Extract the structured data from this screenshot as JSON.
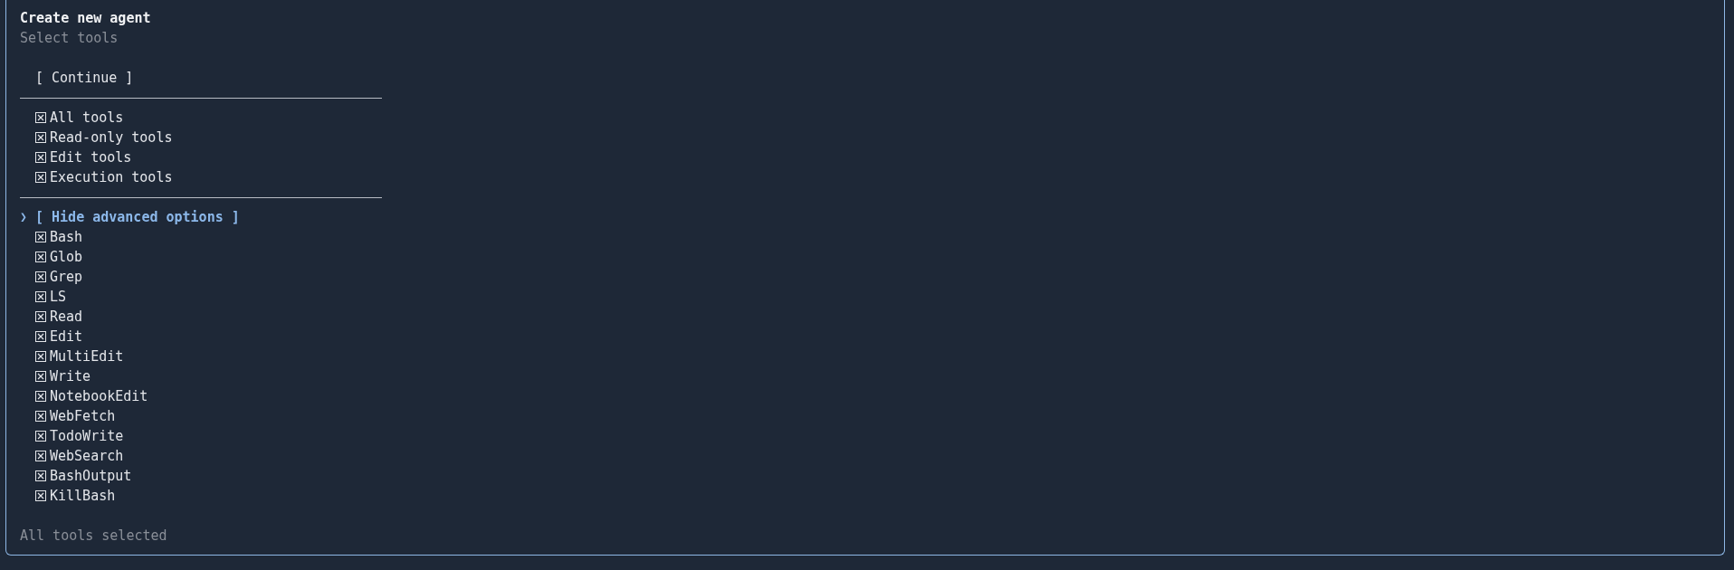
{
  "dialog": {
    "title": "Create new agent",
    "subtitle": "Select tools"
  },
  "continue_button": {
    "label": "[ Continue ]",
    "focused": false
  },
  "tool_groups": [
    {
      "label": "All tools",
      "checked": true
    },
    {
      "label": "Read-only tools",
      "checked": true
    },
    {
      "label": "Edit tools",
      "checked": true
    },
    {
      "label": "Execution tools",
      "checked": true
    }
  ],
  "advanced_toggle": {
    "pointer": "❯",
    "label": "[ Hide advanced options ]",
    "focused": true
  },
  "tools": [
    {
      "label": "Bash",
      "checked": true
    },
    {
      "label": "Glob",
      "checked": true
    },
    {
      "label": "Grep",
      "checked": true
    },
    {
      "label": "LS",
      "checked": true
    },
    {
      "label": "Read",
      "checked": true
    },
    {
      "label": "Edit",
      "checked": true
    },
    {
      "label": "MultiEdit",
      "checked": true
    },
    {
      "label": "Write",
      "checked": true
    },
    {
      "label": "NotebookEdit",
      "checked": true
    },
    {
      "label": "WebFetch",
      "checked": true
    },
    {
      "label": "TodoWrite",
      "checked": true
    },
    {
      "label": "WebSearch",
      "checked": true
    },
    {
      "label": "BashOutput",
      "checked": true
    },
    {
      "label": "KillBash",
      "checked": true
    }
  ],
  "status": "All tools selected"
}
